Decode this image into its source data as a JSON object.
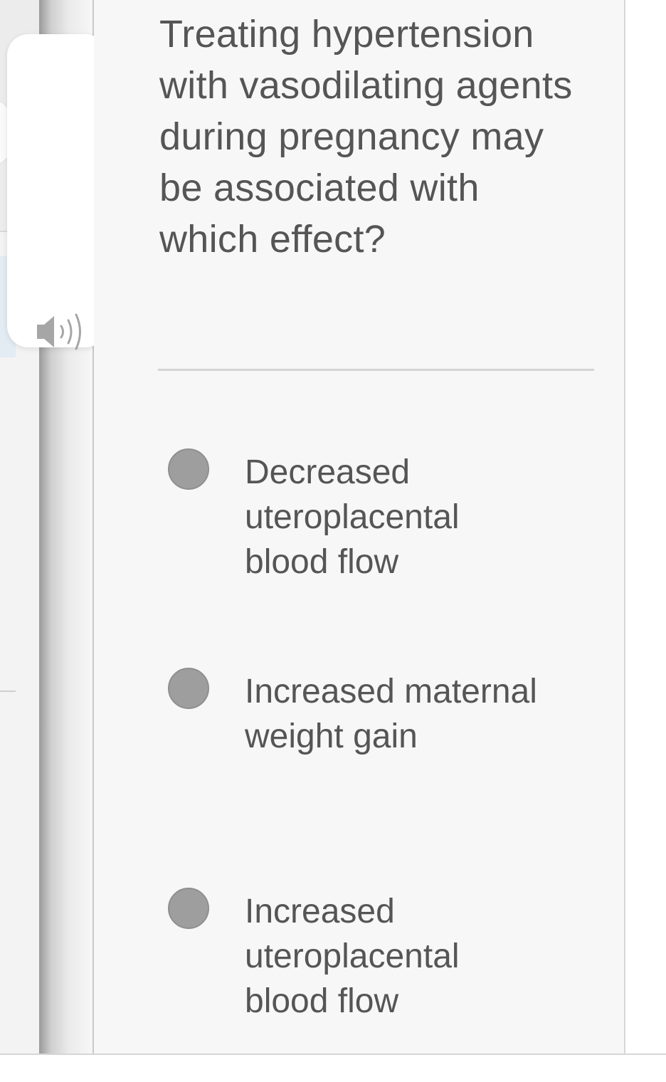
{
  "question": {
    "text": "Treating hypertension with vasodilating agents during pregnancy may be associated with which effect?"
  },
  "options": [
    {
      "label": "Decreased uteroplacental blood flow",
      "selected": false
    },
    {
      "label": "Increased maternal weight gain",
      "selected": false
    },
    {
      "label": "Increased uteroplacental blood flow",
      "selected": false
    }
  ],
  "audio": {
    "icon": "speaker-icon"
  },
  "footer": {
    "text": ""
  },
  "colors": {
    "panel_bg": "#f7f7f7",
    "text": "#555555",
    "radio": "#9e9e9e",
    "divider": "#d3d3d3"
  }
}
